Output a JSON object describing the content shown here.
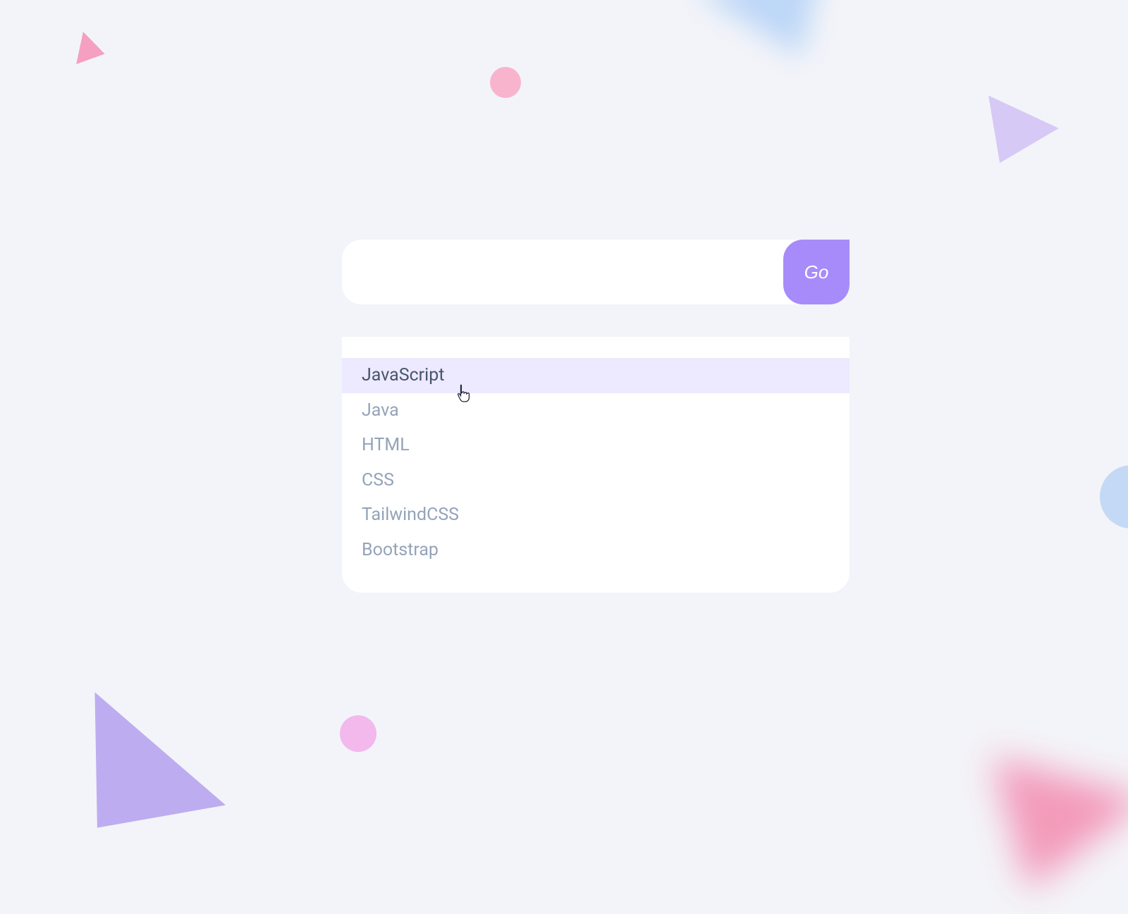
{
  "search": {
    "value": "",
    "go_label": "Go"
  },
  "suggestions": {
    "items": [
      {
        "label": "JavaScript",
        "highlighted": true
      },
      {
        "label": "Java",
        "highlighted": false
      },
      {
        "label": "HTML",
        "highlighted": false
      },
      {
        "label": "CSS",
        "highlighted": false
      },
      {
        "label": "TailwindCSS",
        "highlighted": false
      },
      {
        "label": "Bootstrap",
        "highlighted": false
      }
    ]
  },
  "colors": {
    "accent": "#a78bfa",
    "highlight_bg": "#ede9fe",
    "text_muted": "#94a3b8",
    "text_highlight": "#475569"
  }
}
